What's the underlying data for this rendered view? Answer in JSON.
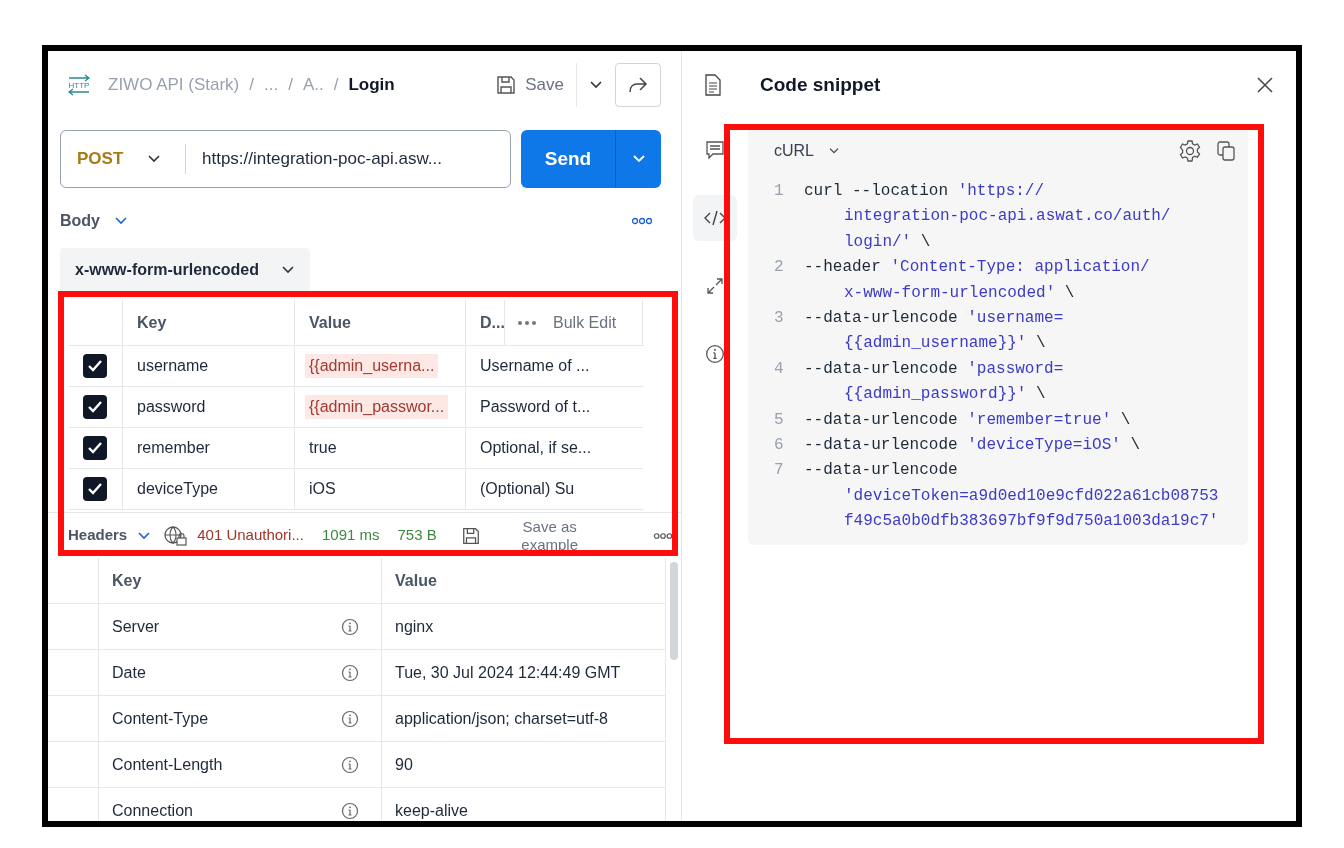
{
  "http_badge": "HTTP",
  "breadcrumb": [
    {
      "kind": "crumb",
      "label": "ZIWO API (Stark)"
    },
    {
      "kind": "separator",
      "label": "/"
    },
    {
      "kind": "crumb",
      "label": "..."
    },
    {
      "kind": "separator",
      "label": "/"
    },
    {
      "kind": "crumb",
      "label": "A.."
    },
    {
      "kind": "separator",
      "label": "/"
    },
    {
      "kind": "current",
      "label": "Login"
    }
  ],
  "save_label": "Save",
  "request": {
    "method": "POST",
    "url": "https://integration-poc-api.asw...",
    "send_label": "Send"
  },
  "body": {
    "label": "Body",
    "body_type": "x-www-form-urlencoded"
  },
  "params_table": {
    "columns": [
      "Key",
      "Value",
      "D..."
    ],
    "bulk_edit": "Bulk Edit",
    "rows": [
      {
        "checked": true,
        "key": "username",
        "value": "{{admin_userna...",
        "variable": true,
        "description": "Username of ..."
      },
      {
        "checked": true,
        "key": "password",
        "value": "{{admin_passwor...",
        "variable": true,
        "description": "Password of t..."
      },
      {
        "checked": true,
        "key": "remember",
        "value": "true",
        "variable": false,
        "description": "Optional, if se..."
      },
      {
        "checked": true,
        "key": "deviceType",
        "value": "iOS",
        "variable": false,
        "description": "(Optional) Su"
      }
    ]
  },
  "response_bar": {
    "tab": "Headers",
    "status": "401 Unauthori...",
    "time": "1091 ms",
    "size": "753 B",
    "save_example": "Save as example"
  },
  "response_headers": {
    "columns": [
      "Key",
      "Value"
    ],
    "rows": [
      {
        "key": "Server",
        "value": "nginx"
      },
      {
        "key": "Date",
        "value": "Tue, 30 Jul 2024 12:44:49 GMT"
      },
      {
        "key": "Content-Type",
        "value": "application/json; charset=utf-8"
      },
      {
        "key": "Content-Length",
        "value": "90"
      },
      {
        "key": "Connection",
        "value": "keep-alive"
      }
    ]
  },
  "side_rail": [
    {
      "kind": "comments",
      "selected": false
    },
    {
      "kind": "code",
      "selected": true
    },
    {
      "kind": "arrows",
      "selected": false
    },
    {
      "kind": "info",
      "selected": false
    }
  ],
  "snippet": {
    "title": "Code snippet",
    "language": "cURL",
    "lines": [
      {
        "number": "1",
        "rows": [
          {
            "command": "curl --location",
            "argument": "'https://"
          },
          {
            "argument": "integration-poc-api.aswat.co/auth/"
          },
          {
            "argument": "login/'",
            "continuation": "\\"
          }
        ]
      },
      {
        "number": "2",
        "rows": [
          {
            "command": "--header",
            "argument": "'Content-Type: application/"
          },
          {
            "argument": "x-www-form-urlencoded'",
            "continuation": "\\"
          }
        ]
      },
      {
        "number": "3",
        "rows": [
          {
            "command": "--data-urlencode",
            "argument": "'username="
          },
          {
            "argument": "{{admin_username}}'",
            "continuation": "\\"
          }
        ]
      },
      {
        "number": "4",
        "rows": [
          {
            "command": "--data-urlencode",
            "argument": "'password="
          },
          {
            "argument": "{{admin_password}}'",
            "continuation": "\\"
          }
        ]
      },
      {
        "number": "5",
        "rows": [
          {
            "command": "--data-urlencode",
            "argument": "'remember=true'",
            "continuation": "\\"
          }
        ]
      },
      {
        "number": "6",
        "rows": [
          {
            "command": "--data-urlencode",
            "argument": "'deviceType=iOS'",
            "continuation": "\\"
          }
        ]
      },
      {
        "number": "7",
        "rows": [
          {
            "command": "--data-urlencode"
          },
          {
            "argument": "'deviceToken=a9d0ed10e9cfd022a61cb08753"
          },
          {
            "argument": "f49c5a0b0dfb383697bf9f9d750a1003da19c7'"
          }
        ]
      }
    ]
  }
}
